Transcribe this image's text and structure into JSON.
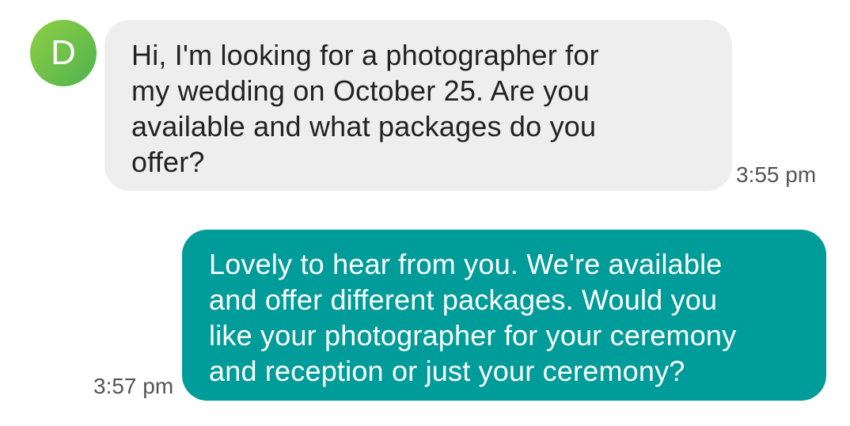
{
  "conversation": {
    "messages": [
      {
        "sender": "contact",
        "avatar_letter": "D",
        "lines": [
          "Hi, I'm looking for a photographer for",
          "my wedding on October 25. Are you",
          "available and what packages do you",
          "offer?"
        ],
        "time": "3:55 pm"
      },
      {
        "sender": "me",
        "lines": [
          "Lovely to hear from you. We're available",
          "and offer different packages. Would you",
          "like your photographer for your ceremony",
          "and reception or just your ceremony?"
        ],
        "time": "3:57 pm"
      }
    ]
  },
  "colors": {
    "avatar_green": "#6cc04a",
    "incoming_bubble": "#eeeeee",
    "outgoing_bubble": "#009c9a"
  }
}
